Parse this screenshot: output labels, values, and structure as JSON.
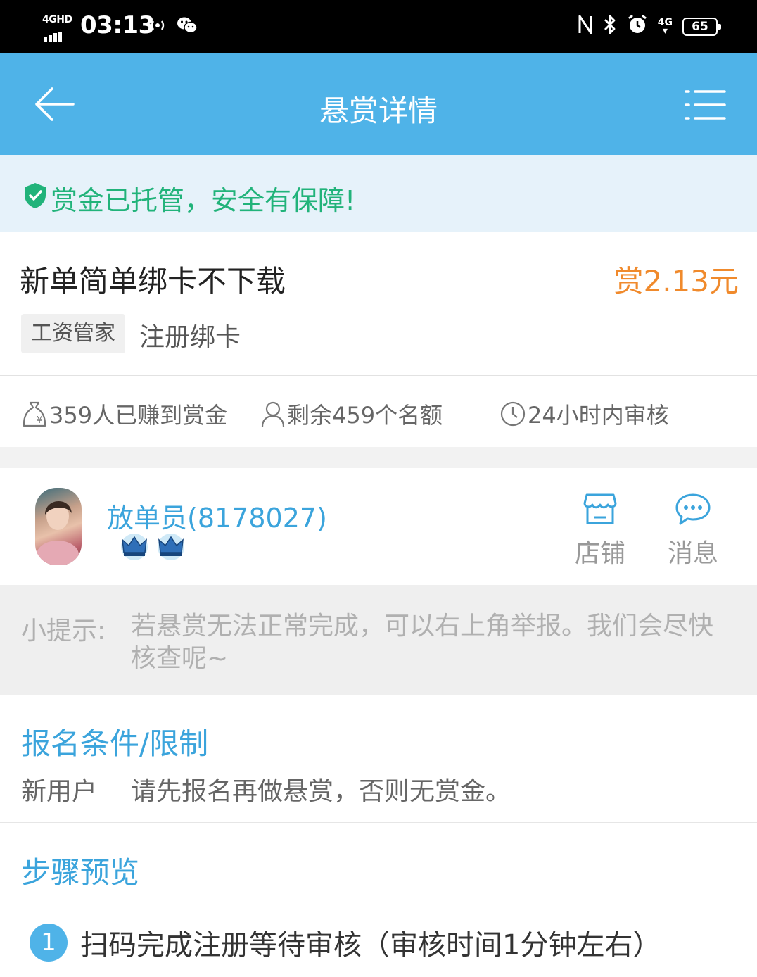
{
  "status_bar": {
    "network": "4GHD",
    "time": "03:13",
    "signal_4g": "4G",
    "battery": "65"
  },
  "header": {
    "title": "悬赏详情"
  },
  "escrow_banner": {
    "text": "赏金已托管，安全有保障!"
  },
  "task": {
    "title": "新单简单绑卡不下载",
    "reward": "赏2.13元",
    "app_tag": "工资管家",
    "type_tag": "注册绑卡"
  },
  "stats": {
    "earned": "359人已赚到赏金",
    "remaining": "剩余459个名额",
    "review": "24小时内审核"
  },
  "publisher": {
    "name": "放单员(8178027)",
    "crown_count": 2,
    "shop_label": "店铺",
    "message_label": "消息"
  },
  "tip": {
    "label": "小提示:",
    "text": "若悬赏无法正常完成，可以右上角举报。我们会尽快核查呢~"
  },
  "requirements": {
    "title": "报名条件/限制",
    "label": "新用户",
    "text": "请先报名再做悬赏，否则无赏金。"
  },
  "steps": {
    "title": "步骤预览",
    "items": [
      {
        "num": "1",
        "text": "扫码完成注册等待审核（审核时间1分钟左右）"
      }
    ]
  },
  "colors": {
    "header_bg": "#4fb3e8",
    "escrow_bg": "#e6f2fa",
    "escrow_text": "#21b37a",
    "reward_text": "#f08a2c",
    "section_title": "#3ba4dc"
  }
}
